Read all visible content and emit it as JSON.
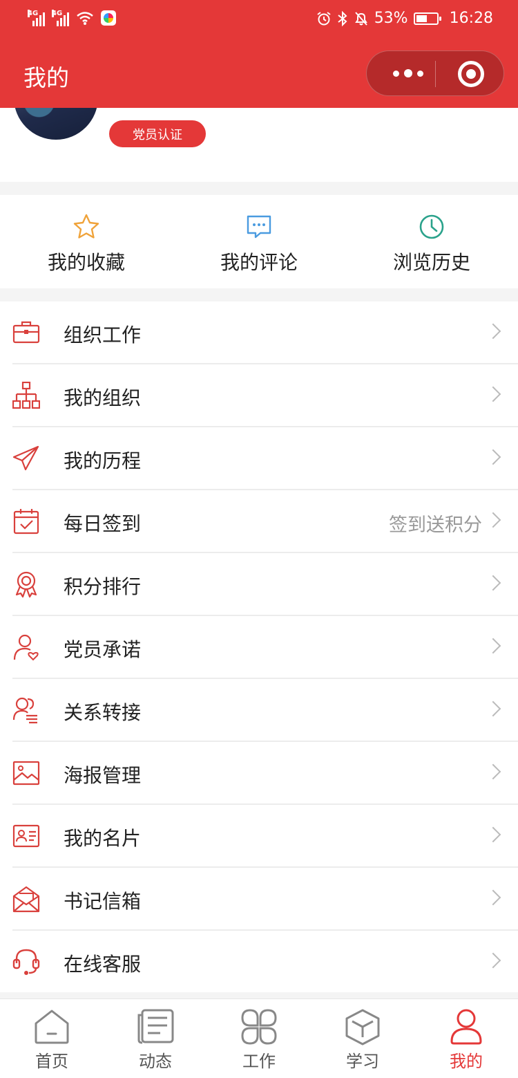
{
  "status_bar": {
    "sim1": "4G",
    "sim2": "4G",
    "battery_pct": "53%",
    "battery_level": 0.53,
    "time": "16:28",
    "icons": [
      "signal-icon",
      "wifi-icon",
      "app-icon",
      "alarm-icon",
      "bluetooth-icon",
      "mute-icon",
      "battery-icon"
    ]
  },
  "nav": {
    "title": "我的"
  },
  "profile": {
    "badge": "党员认证"
  },
  "quick_actions": [
    {
      "label": "我的收藏",
      "icon": "star-icon",
      "color": "#f0a33a"
    },
    {
      "label": "我的评论",
      "icon": "comment-icon",
      "color": "#4a9be0"
    },
    {
      "label": "浏览历史",
      "icon": "clock-icon",
      "color": "#2aa28b"
    }
  ],
  "menu": [
    {
      "label": "组织工作",
      "icon": "briefcase-icon",
      "extra": ""
    },
    {
      "label": "我的组织",
      "icon": "org-chart-icon",
      "extra": ""
    },
    {
      "label": "我的历程",
      "icon": "paper-plane-icon",
      "extra": ""
    },
    {
      "label": "每日签到",
      "icon": "calendar-check-icon",
      "extra": "签到送积分"
    },
    {
      "label": "积分排行",
      "icon": "award-icon",
      "extra": ""
    },
    {
      "label": "党员承诺",
      "icon": "user-heart-icon",
      "extra": ""
    },
    {
      "label": "关系转接",
      "icon": "users-transfer-icon",
      "extra": ""
    },
    {
      "label": "海报管理",
      "icon": "image-icon",
      "extra": ""
    },
    {
      "label": "我的名片",
      "icon": "id-card-icon",
      "extra": ""
    },
    {
      "label": "书记信箱",
      "icon": "mail-open-icon",
      "extra": ""
    },
    {
      "label": "在线客服",
      "icon": "headset-icon",
      "extra": ""
    }
  ],
  "tabbar": [
    {
      "label": "首页",
      "icon": "home-icon",
      "active": false
    },
    {
      "label": "动态",
      "icon": "news-icon",
      "active": false
    },
    {
      "label": "工作",
      "icon": "grid-icon",
      "active": false
    },
    {
      "label": "学习",
      "icon": "cube-icon",
      "active": false
    },
    {
      "label": "我的",
      "icon": "user-icon",
      "active": true
    }
  ],
  "colors": {
    "primary": "#e43838",
    "icon_red": "#d9403c",
    "chevron": "#bbbbbb"
  }
}
